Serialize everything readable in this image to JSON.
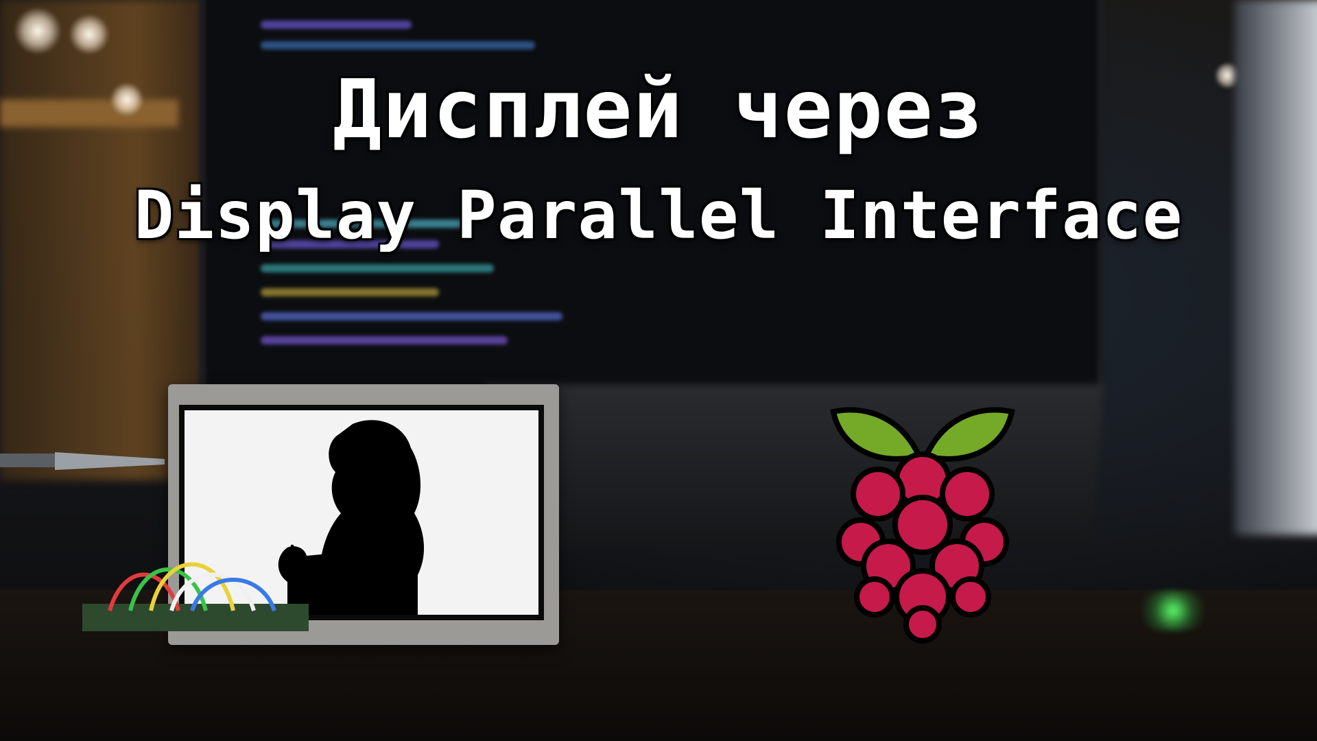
{
  "title": {
    "line1": "Дисплей через",
    "line2": "Display Parallel Interface"
  },
  "colors": {
    "title_text": "#ffffff",
    "title_outline": "#000000",
    "raspberry_berry": "#c51a4a",
    "raspberry_leaf": "#75a928",
    "lcd_frame": "#9b9a96"
  },
  "icons": {
    "logo": "raspberry-pi-logo-icon",
    "display": "lcd-display-module",
    "silhouette": "girl-with-apple-silhouette"
  }
}
